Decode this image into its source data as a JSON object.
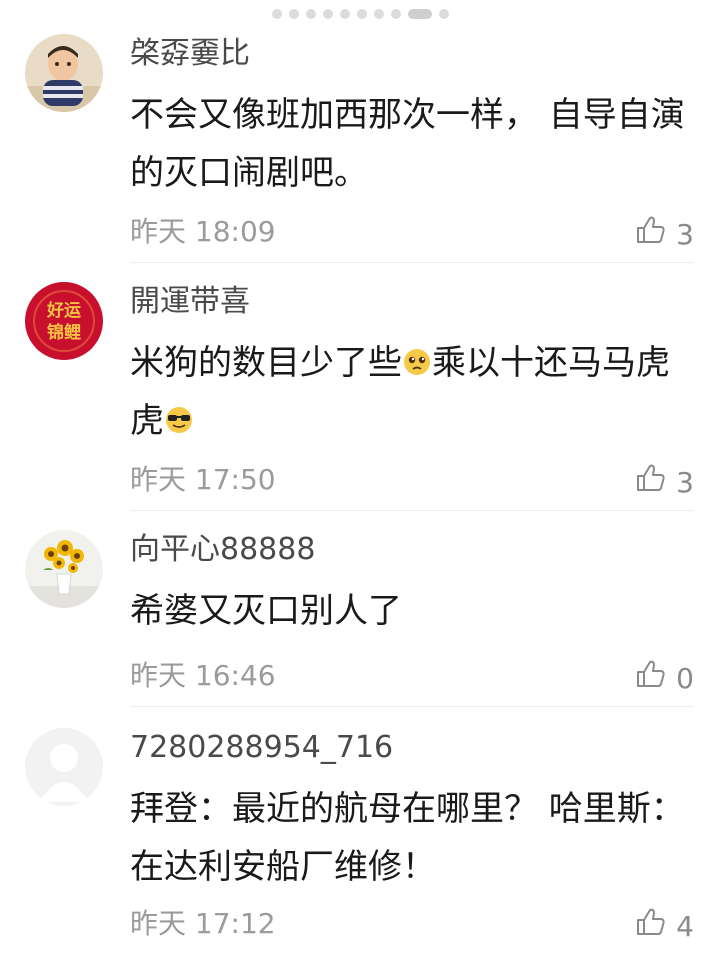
{
  "pager": {
    "count": 10,
    "active_index": 8
  },
  "comments": [
    {
      "username": "棨孬嫑比",
      "text": "不会又像班加西那次一样， 自导自演的灭口闹剧吧。",
      "time": "昨天 18:09",
      "likes": "3",
      "avatar_icon": "baby-photo-avatar"
    },
    {
      "username": "開運带喜",
      "text_parts": [
        "米狗的数目少了些",
        "乘以十还马马虎虎"
      ],
      "emojis": [
        "pleading-face-emoji",
        "sunglasses-face-emoji"
      ],
      "time": "昨天 17:50",
      "likes": "3",
      "avatar_icon": "lucky-koi-avatar",
      "avatar_text": "好运锦鲤"
    },
    {
      "username": "向平心88888",
      "text": "希婆又灭口别人了",
      "time": "昨天 16:46",
      "likes": "0",
      "avatar_icon": "sunflower-vase-avatar"
    },
    {
      "username": "7280288954_716",
      "text": "拜登：最近的航母在哪里？ 哈里斯：在达利安船厂维修！",
      "time": "昨天 17:12",
      "likes": "4",
      "avatar_icon": "default-user-avatar"
    }
  ],
  "colors": {
    "username": "#4a4a4a",
    "text": "#1a1a1a",
    "meta": "#9b9b9b",
    "koi_red": "#c8102e",
    "koi_gold": "#f5c542"
  }
}
